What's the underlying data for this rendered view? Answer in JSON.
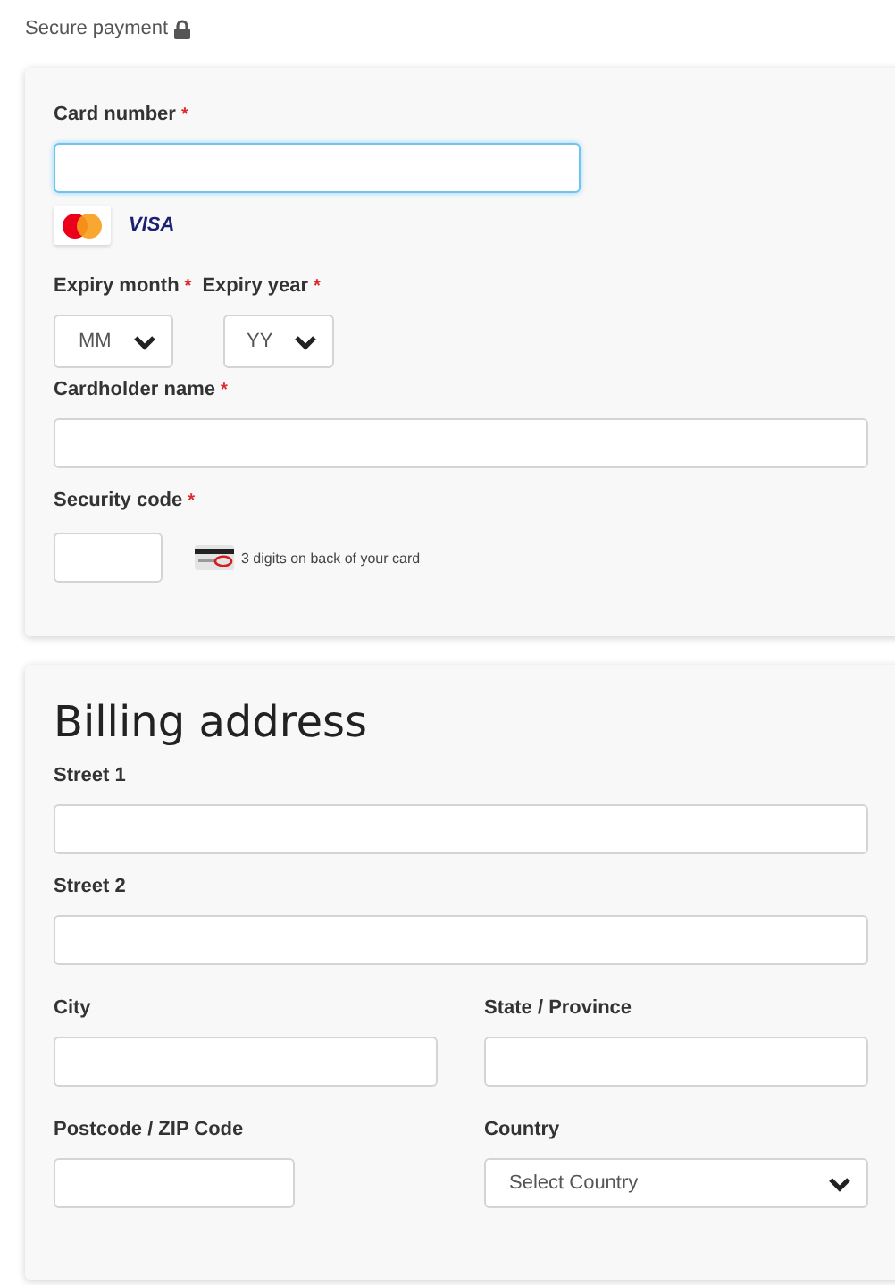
{
  "header": {
    "title": "Secure payment"
  },
  "required_marker": "*",
  "card": {
    "card_number": {
      "label": "Card number",
      "required": true,
      "focused": true
    },
    "brands": [
      {
        "kind": "mastercard"
      },
      {
        "kind": "visa",
        "label": "VISA"
      }
    ],
    "expiry_month": {
      "label": "Expiry month",
      "required": true,
      "value": "MM"
    },
    "expiry_year": {
      "label": "Expiry year",
      "required": true,
      "value": "YY"
    },
    "cardholder_name": {
      "label": "Cardholder name",
      "required": true,
      "focused": false
    },
    "security_code": {
      "label": "Security code",
      "required": true,
      "focused": false,
      "hint": "3 digits on back of your card"
    }
  },
  "billing": {
    "title": "Billing address",
    "rows": [
      [
        {
          "kind": "text",
          "label": "Street 1"
        }
      ],
      [
        {
          "kind": "text",
          "label": "Street 2"
        }
      ],
      [
        {
          "kind": "text",
          "label": "City"
        },
        {
          "kind": "text",
          "label": "State / Province"
        }
      ],
      [
        {
          "kind": "short_text",
          "label": "Postcode / ZIP Code"
        },
        {
          "kind": "select",
          "label": "Country",
          "value": "Select Country"
        }
      ]
    ]
  }
}
